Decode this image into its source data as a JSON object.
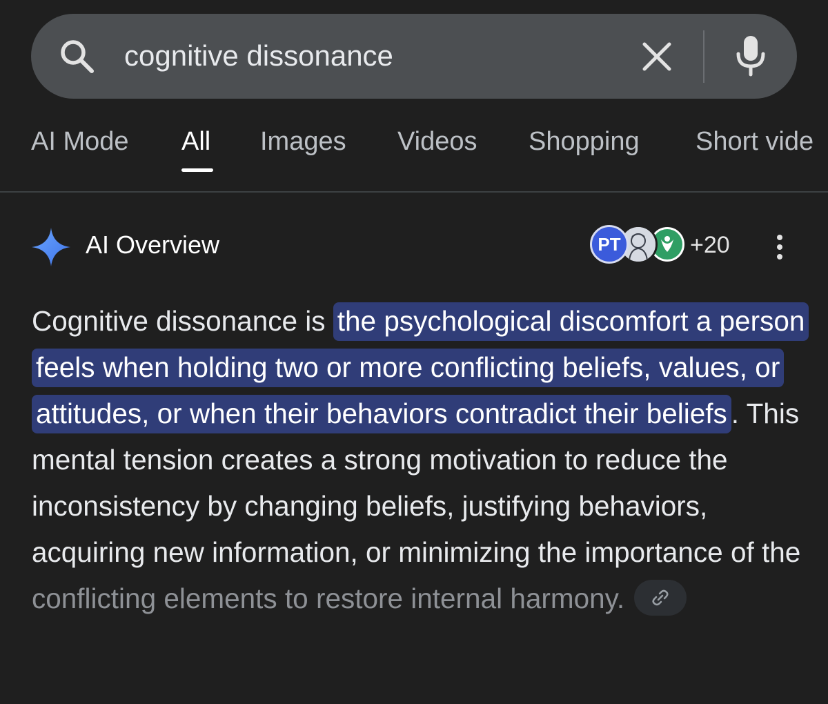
{
  "search": {
    "query": "cognitive dissonance"
  },
  "tabs": [
    {
      "label": "AI Mode"
    },
    {
      "label": "All"
    },
    {
      "label": "Images"
    },
    {
      "label": "Videos"
    },
    {
      "label": "Shopping"
    },
    {
      "label": "Short vide"
    }
  ],
  "active_tab": "All",
  "ai_overview": {
    "title": "AI Overview",
    "source_avatar_pt": "PT",
    "source_count": "+20",
    "text_intro": "Cognitive dissonance is",
    "text_highlight": "the psychological discomfort a person feels when holding two or more conflicting beliefs, values, or attitudes, or when their behaviors contradict their beliefs",
    "text_after": ". This mental tension creates a strong motivation to reduce the inconsistency by changing beliefs, justifying behaviors, acquiring new information, or minimizing the importance of the",
    "text_faded": "conflicting elements to restore internal harmony."
  },
  "icons": {
    "search": "search-icon",
    "clear": "close-icon",
    "mic": "microphone-icon",
    "sparkle": "sparkle-icon",
    "more": "more-vert-icon",
    "link": "link-icon"
  },
  "colors": {
    "background": "#1f1f1f",
    "search_bar": "#4c4f52",
    "highlight": "#303d78",
    "sparkle": "#4c8df6"
  }
}
